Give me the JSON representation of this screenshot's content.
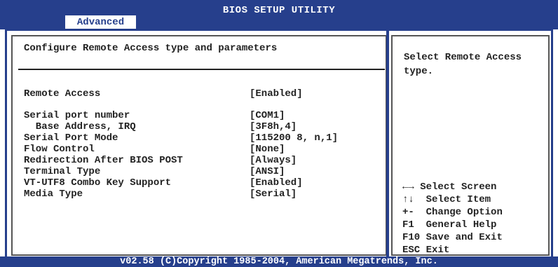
{
  "app": {
    "title": "BIOS SETUP UTILITY",
    "active_tab": "Advanced"
  },
  "main": {
    "header": "Configure Remote Access type and parameters",
    "settings": [
      {
        "label": "Remote Access",
        "value": "[Enabled]"
      },
      {
        "label": "Serial port number",
        "value": "[COM1]"
      },
      {
        "label": "  Base Address, IRQ",
        "value": "[3F8h,4]"
      },
      {
        "label": "Serial Port Mode",
        "value": "[115200 8, n,1]"
      },
      {
        "label": "Flow Control",
        "value": "[None]"
      },
      {
        "label": "Redirection After BIOS POST",
        "value": "[Always]"
      },
      {
        "label": "Terminal Type",
        "value": "[ANSI]"
      },
      {
        "label": "VT-UTF8 Combo Key Support",
        "value": "[Enabled]"
      },
      {
        "label": "Media Type",
        "value": "[Serial]"
      }
    ]
  },
  "help": {
    "text": "Select Remote Access type.",
    "keys": [
      {
        "key": "←→",
        "action": "Select Screen"
      },
      {
        "key": "↑↓",
        "action": "Select Item"
      },
      {
        "key": "+-",
        "action": "Change Option"
      },
      {
        "key": "F1",
        "action": "General Help"
      },
      {
        "key": "F10",
        "action": "Save and Exit"
      },
      {
        "key": "ESC",
        "action": "Exit"
      }
    ]
  },
  "footer": "v02.58 (C)Copyright 1985-2004, American Megatrends, Inc.",
  "colors": {
    "accent": "#263f8c",
    "background": "#ffffff",
    "text": "#222222"
  }
}
